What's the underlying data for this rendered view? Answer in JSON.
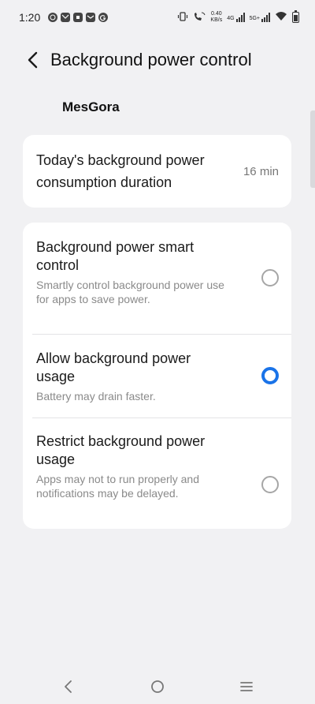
{
  "status_bar": {
    "time": "1:20",
    "net_speed_value": "0.40",
    "net_speed_unit": "KB/s",
    "network_type": "4G",
    "network_type_2": "5G+",
    "left_icons": [
      "whatsapp-icon",
      "gmail-icon",
      "app-icon",
      "message-icon",
      "google-icon"
    ],
    "right_icons": [
      "vibrate-icon",
      "wifi-calling-icon",
      "signal-icon",
      "wifi-icon",
      "battery-icon"
    ]
  },
  "header": {
    "title": "Background power control",
    "back_icon": "chevron-left-icon"
  },
  "app": {
    "name": "MesGora"
  },
  "consumption": {
    "label": "Today's background power consumption duration",
    "value": "16 min"
  },
  "options": [
    {
      "title": "Background power smart control",
      "description": "Smartly control background power use for apps to save power.",
      "selected": false
    },
    {
      "title": "Allow background power usage",
      "description": "Battery may drain faster.",
      "selected": true
    },
    {
      "title": "Restrict background power usage",
      "description": "Apps may not to run properly and notifications may be delayed.",
      "selected": false
    }
  ],
  "nav_bar": {
    "icons": [
      "nav-back-icon",
      "nav-home-icon",
      "nav-recent-icon"
    ]
  },
  "colors": {
    "background": "#f1f1f3",
    "card": "#ffffff",
    "accent": "#1a73e8",
    "secondary_text": "#8a8a8a"
  }
}
